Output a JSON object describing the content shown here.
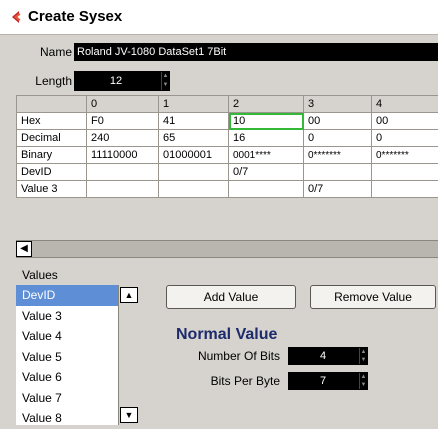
{
  "window": {
    "title": "Create Sysex"
  },
  "name_field": {
    "label": "Name",
    "value": "Roland JV-1080 DataSet1 7Bit"
  },
  "length_field": {
    "label": "Length",
    "value": "12"
  },
  "grid": {
    "columns": [
      "0",
      "1",
      "2",
      "3",
      "4"
    ],
    "rows": [
      {
        "label": "Hex",
        "cells": [
          "F0",
          "41",
          "10",
          "00",
          "00"
        ]
      },
      {
        "label": "Decimal",
        "cells": [
          "240",
          "65",
          "16",
          "0",
          "0"
        ]
      },
      {
        "label": "Binary",
        "cells": [
          "11110000",
          "01000001",
          "0001****",
          "0*******",
          "0*******"
        ]
      },
      {
        "label": "DevID",
        "cells": [
          "",
          "",
          "0/7",
          "",
          ""
        ]
      },
      {
        "label": "Value 3",
        "cells": [
          "",
          "",
          "",
          "0/7",
          ""
        ]
      }
    ],
    "selected_cell": {
      "row": "Hex",
      "column": "2"
    }
  },
  "values_panel": {
    "title": "Values",
    "items": [
      "DevID",
      "Value 3",
      "Value 4",
      "Value 5",
      "Value 6",
      "Value 7",
      "Value 8"
    ],
    "selected": "DevID"
  },
  "buttons": {
    "add_value": "Add Value",
    "remove_value": "Remove Value"
  },
  "normal_value": {
    "heading": "Normal Value",
    "number_of_bits_label": "Number Of Bits",
    "number_of_bits_value": "4",
    "bits_per_byte_label": "Bits Per Byte",
    "bits_per_byte_value": "7"
  },
  "colors": {
    "selection": "#5e8fd6",
    "selected_cell_border": "#34b838",
    "heading": "#1d2a6b",
    "logo": "#c8232c"
  },
  "icons": {
    "logo": "cubase-logo",
    "scroll_left": "arrow-left-icon",
    "scroll_up": "arrow-up-icon",
    "scroll_down": "arrow-down-icon"
  }
}
